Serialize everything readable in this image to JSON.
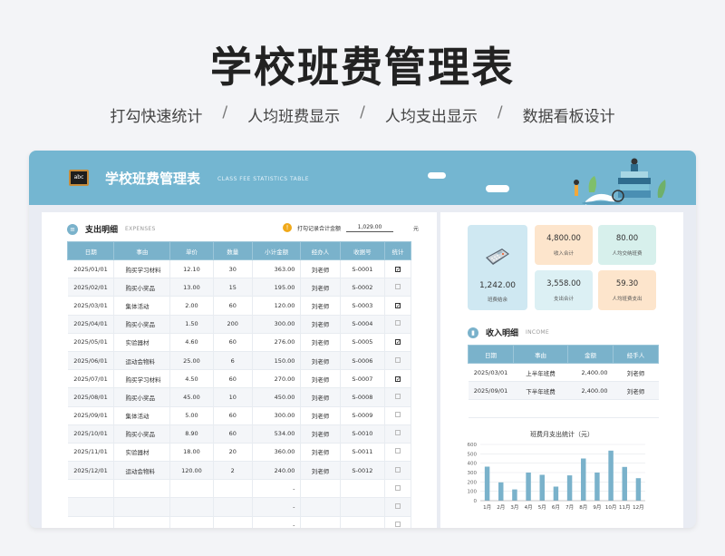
{
  "hero": {
    "title": "学校班费管理表",
    "features": [
      "打勾快速统计",
      "人均班费显示",
      "人均支出显示",
      "数据看板设计"
    ],
    "separator": "/"
  },
  "header": {
    "board_text": "abc",
    "title": "学校班费管理表",
    "subtitle_en": "CLASS FEE STATISTICS TABLE"
  },
  "expenses": {
    "title": "支出明细",
    "title_en": "EXPENSES",
    "checked_total_label": "打勾记录合计金额",
    "checked_total_value": "1,029.00",
    "unit": "元",
    "columns": [
      "日期",
      "事由",
      "单价",
      "数量",
      "小计金额",
      "经办人",
      "收据号",
      "统计"
    ],
    "rows": [
      {
        "date": "2025/01/01",
        "item": "购买学习材料",
        "price": "12.10",
        "qty": "30",
        "subtotal": "363.00",
        "handler": "刘老师",
        "receipt": "S-0001",
        "checked": true
      },
      {
        "date": "2025/02/01",
        "item": "购买小奖品",
        "price": "13.00",
        "qty": "15",
        "subtotal": "195.00",
        "handler": "刘老师",
        "receipt": "S-0002",
        "checked": false
      },
      {
        "date": "2025/03/01",
        "item": "集体活动",
        "price": "2.00",
        "qty": "60",
        "subtotal": "120.00",
        "handler": "刘老师",
        "receipt": "S-0003",
        "checked": true
      },
      {
        "date": "2025/04/01",
        "item": "购买小奖品",
        "price": "1.50",
        "qty": "200",
        "subtotal": "300.00",
        "handler": "刘老师",
        "receipt": "S-0004",
        "checked": false
      },
      {
        "date": "2025/05/01",
        "item": "实验器材",
        "price": "4.60",
        "qty": "60",
        "subtotal": "276.00",
        "handler": "刘老师",
        "receipt": "S-0005",
        "checked": true
      },
      {
        "date": "2025/06/01",
        "item": "运动会物料",
        "price": "25.00",
        "qty": "6",
        "subtotal": "150.00",
        "handler": "刘老师",
        "receipt": "S-0006",
        "checked": false
      },
      {
        "date": "2025/07/01",
        "item": "购买学习材料",
        "price": "4.50",
        "qty": "60",
        "subtotal": "270.00",
        "handler": "刘老师",
        "receipt": "S-0007",
        "checked": true
      },
      {
        "date": "2025/08/01",
        "item": "购买小奖品",
        "price": "45.00",
        "qty": "10",
        "subtotal": "450.00",
        "handler": "刘老师",
        "receipt": "S-0008",
        "checked": false
      },
      {
        "date": "2025/09/01",
        "item": "集体活动",
        "price": "5.00",
        "qty": "60",
        "subtotal": "300.00",
        "handler": "刘老师",
        "receipt": "S-0009",
        "checked": false
      },
      {
        "date": "2025/10/01",
        "item": "购买小奖品",
        "price": "8.90",
        "qty": "60",
        "subtotal": "534.00",
        "handler": "刘老师",
        "receipt": "S-0010",
        "checked": false
      },
      {
        "date": "2025/11/01",
        "item": "实验器材",
        "price": "18.00",
        "qty": "20",
        "subtotal": "360.00",
        "handler": "刘老师",
        "receipt": "S-0011",
        "checked": false
      },
      {
        "date": "2025/12/01",
        "item": "运动会物料",
        "price": "120.00",
        "qty": "2",
        "subtotal": "240.00",
        "handler": "刘老师",
        "receipt": "S-0012",
        "checked": false
      },
      {
        "date": "",
        "item": "",
        "price": "",
        "qty": "",
        "subtotal": "-",
        "handler": "",
        "receipt": "",
        "checked": false
      },
      {
        "date": "",
        "item": "",
        "price": "",
        "qty": "",
        "subtotal": "-",
        "handler": "",
        "receipt": "",
        "checked": false
      },
      {
        "date": "",
        "item": "",
        "price": "",
        "qty": "",
        "subtotal": "-",
        "handler": "",
        "receipt": "",
        "checked": false
      }
    ]
  },
  "dashboard": {
    "balance": {
      "value": "1,242.00",
      "label": "班费结余"
    },
    "income_total": {
      "value": "4,800.00",
      "label": "收入合计"
    },
    "expense_total": {
      "value": "3,558.00",
      "label": "支出合计"
    },
    "per_capita_fee": {
      "value": "80.00",
      "label": "人均交纳班费"
    },
    "per_capita_expense": {
      "value": "59.30",
      "label": "人均班费支出"
    }
  },
  "income": {
    "title": "收入明细",
    "title_en": "INCOME",
    "columns": [
      "日期",
      "事由",
      "金额",
      "经手人"
    ],
    "rows": [
      {
        "date": "2025/03/01",
        "item": "上半年班费",
        "amount": "2,400.00",
        "handler": "刘老师"
      },
      {
        "date": "2025/09/01",
        "item": "下半年班费",
        "amount": "2,400.00",
        "handler": "刘老师"
      },
      {
        "date": "",
        "item": "",
        "amount": "",
        "handler": ""
      }
    ]
  },
  "chart_data": {
    "type": "bar",
    "title": "班费月支出统计（元）",
    "categories": [
      "1月",
      "2月",
      "3月",
      "4月",
      "5月",
      "6月",
      "7月",
      "8月",
      "9月",
      "10月",
      "11月",
      "12月"
    ],
    "values": [
      363,
      195,
      120,
      300,
      276,
      150,
      270,
      450,
      300,
      534,
      360,
      240
    ],
    "ylim": [
      0,
      600
    ],
    "yticks": [
      0,
      100,
      200,
      300,
      400,
      500,
      600
    ],
    "bar_color": "#7ab2cb"
  },
  "colors": {
    "header": "#74b6d1",
    "table_header": "#7ab2cb",
    "balance_bg": "#cfe8f2",
    "income_bg": "#fde5cc",
    "fee_bg": "#d7f0ec",
    "expense_bg": "#dcf0f4",
    "expense_pc_bg": "#fde5cc"
  }
}
